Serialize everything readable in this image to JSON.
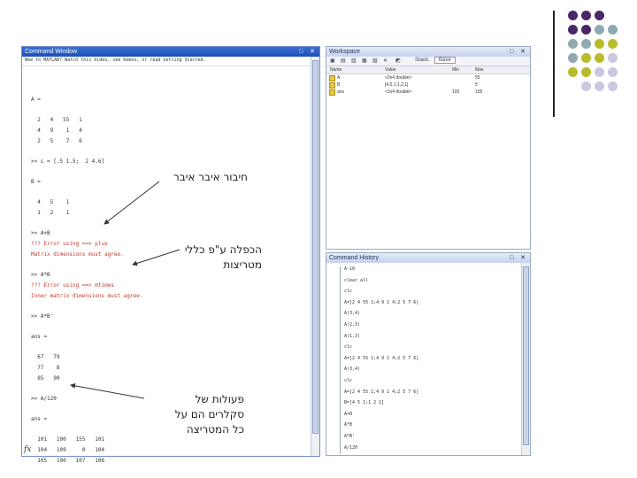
{
  "colors": {
    "dot_purple": "#4a2868",
    "dot_teal": "#8eaab0",
    "dot_olive": "#b8bc2a",
    "dot_lavender": "#c8c8e0",
    "title_blue": "#1c4fb8"
  },
  "command_window": {
    "title": "Command Window",
    "controls": "□ ✕",
    "hint": "New to MATLAB? Watch this Video, see Demos, or read Getting Started.",
    "lines": [
      "A =",
      "  2   4   55   1",
      "  4   9    1   4",
      "  2   5    7   6",
      ">> c = [.5 1.5;  2 4.6]",
      "B =",
      "  4   5    1",
      "  1   2    1",
      ">> A+B",
      "??? Error using ==> plus",
      "Matrix dimensions must agree.",
      ">> A*B",
      "??? Error using ==> mtimes",
      "Inner matrix dimensions must agree.",
      ">> A*B'",
      "ans =",
      "  67   79",
      "  77    8",
      "  85   90",
      ">> A/120",
      "ans =",
      "  101   100   155   101",
      "  104   109     0   104",
      "  105   100   107   106"
    ],
    "fx": "fx"
  },
  "workspace": {
    "title": "Workspace",
    "controls": "□ ✕",
    "toolbar": {
      "stack_label": "Stack:",
      "stack_value": "Base"
    },
    "columns": [
      "Name",
      "Value",
      "Min",
      "Max"
    ],
    "rows": [
      {
        "name": "A",
        "value": "<3x4 double>",
        "min": "",
        "max": "55"
      },
      {
        "name": "B",
        "value": "[4,5,1;1,2,1]",
        "min": "",
        "max": "5"
      },
      {
        "name": "ans",
        "value": "<3x4 double>",
        "min": "100",
        "max": "155"
      }
    ]
  },
  "command_history": {
    "title": "Command History",
    "controls": "□ ✕",
    "entries": [
      "A-10",
      "clear all",
      "clc",
      "A=[2 4 55 1;4 9 1 4;2 5 7 6]",
      "A(3,4)",
      "A(2,3)",
      "A(1,3)",
      "clc",
      "A=[2 4 55 1;4 9 1 4;2 5 7 6]",
      "A(3,4)",
      "clc",
      "A=[2 4 55 1;4 9 1 4;2 5 7 6]",
      "B=[4 5 1;1 2 1]",
      "A+B",
      "A*B",
      "A*B'",
      "A/120"
    ]
  },
  "annotations": {
    "elementwise_add": "חיבור איבר איבר",
    "matrix_mult_line1": "הכפלה ע\"פ כללי",
    "matrix_mult_line2": "מטריצות",
    "scalar_ops_line1": "פעולות של",
    "scalar_ops_line2": "סקלרים הם על",
    "scalar_ops_line3": "כל המטריצה"
  }
}
